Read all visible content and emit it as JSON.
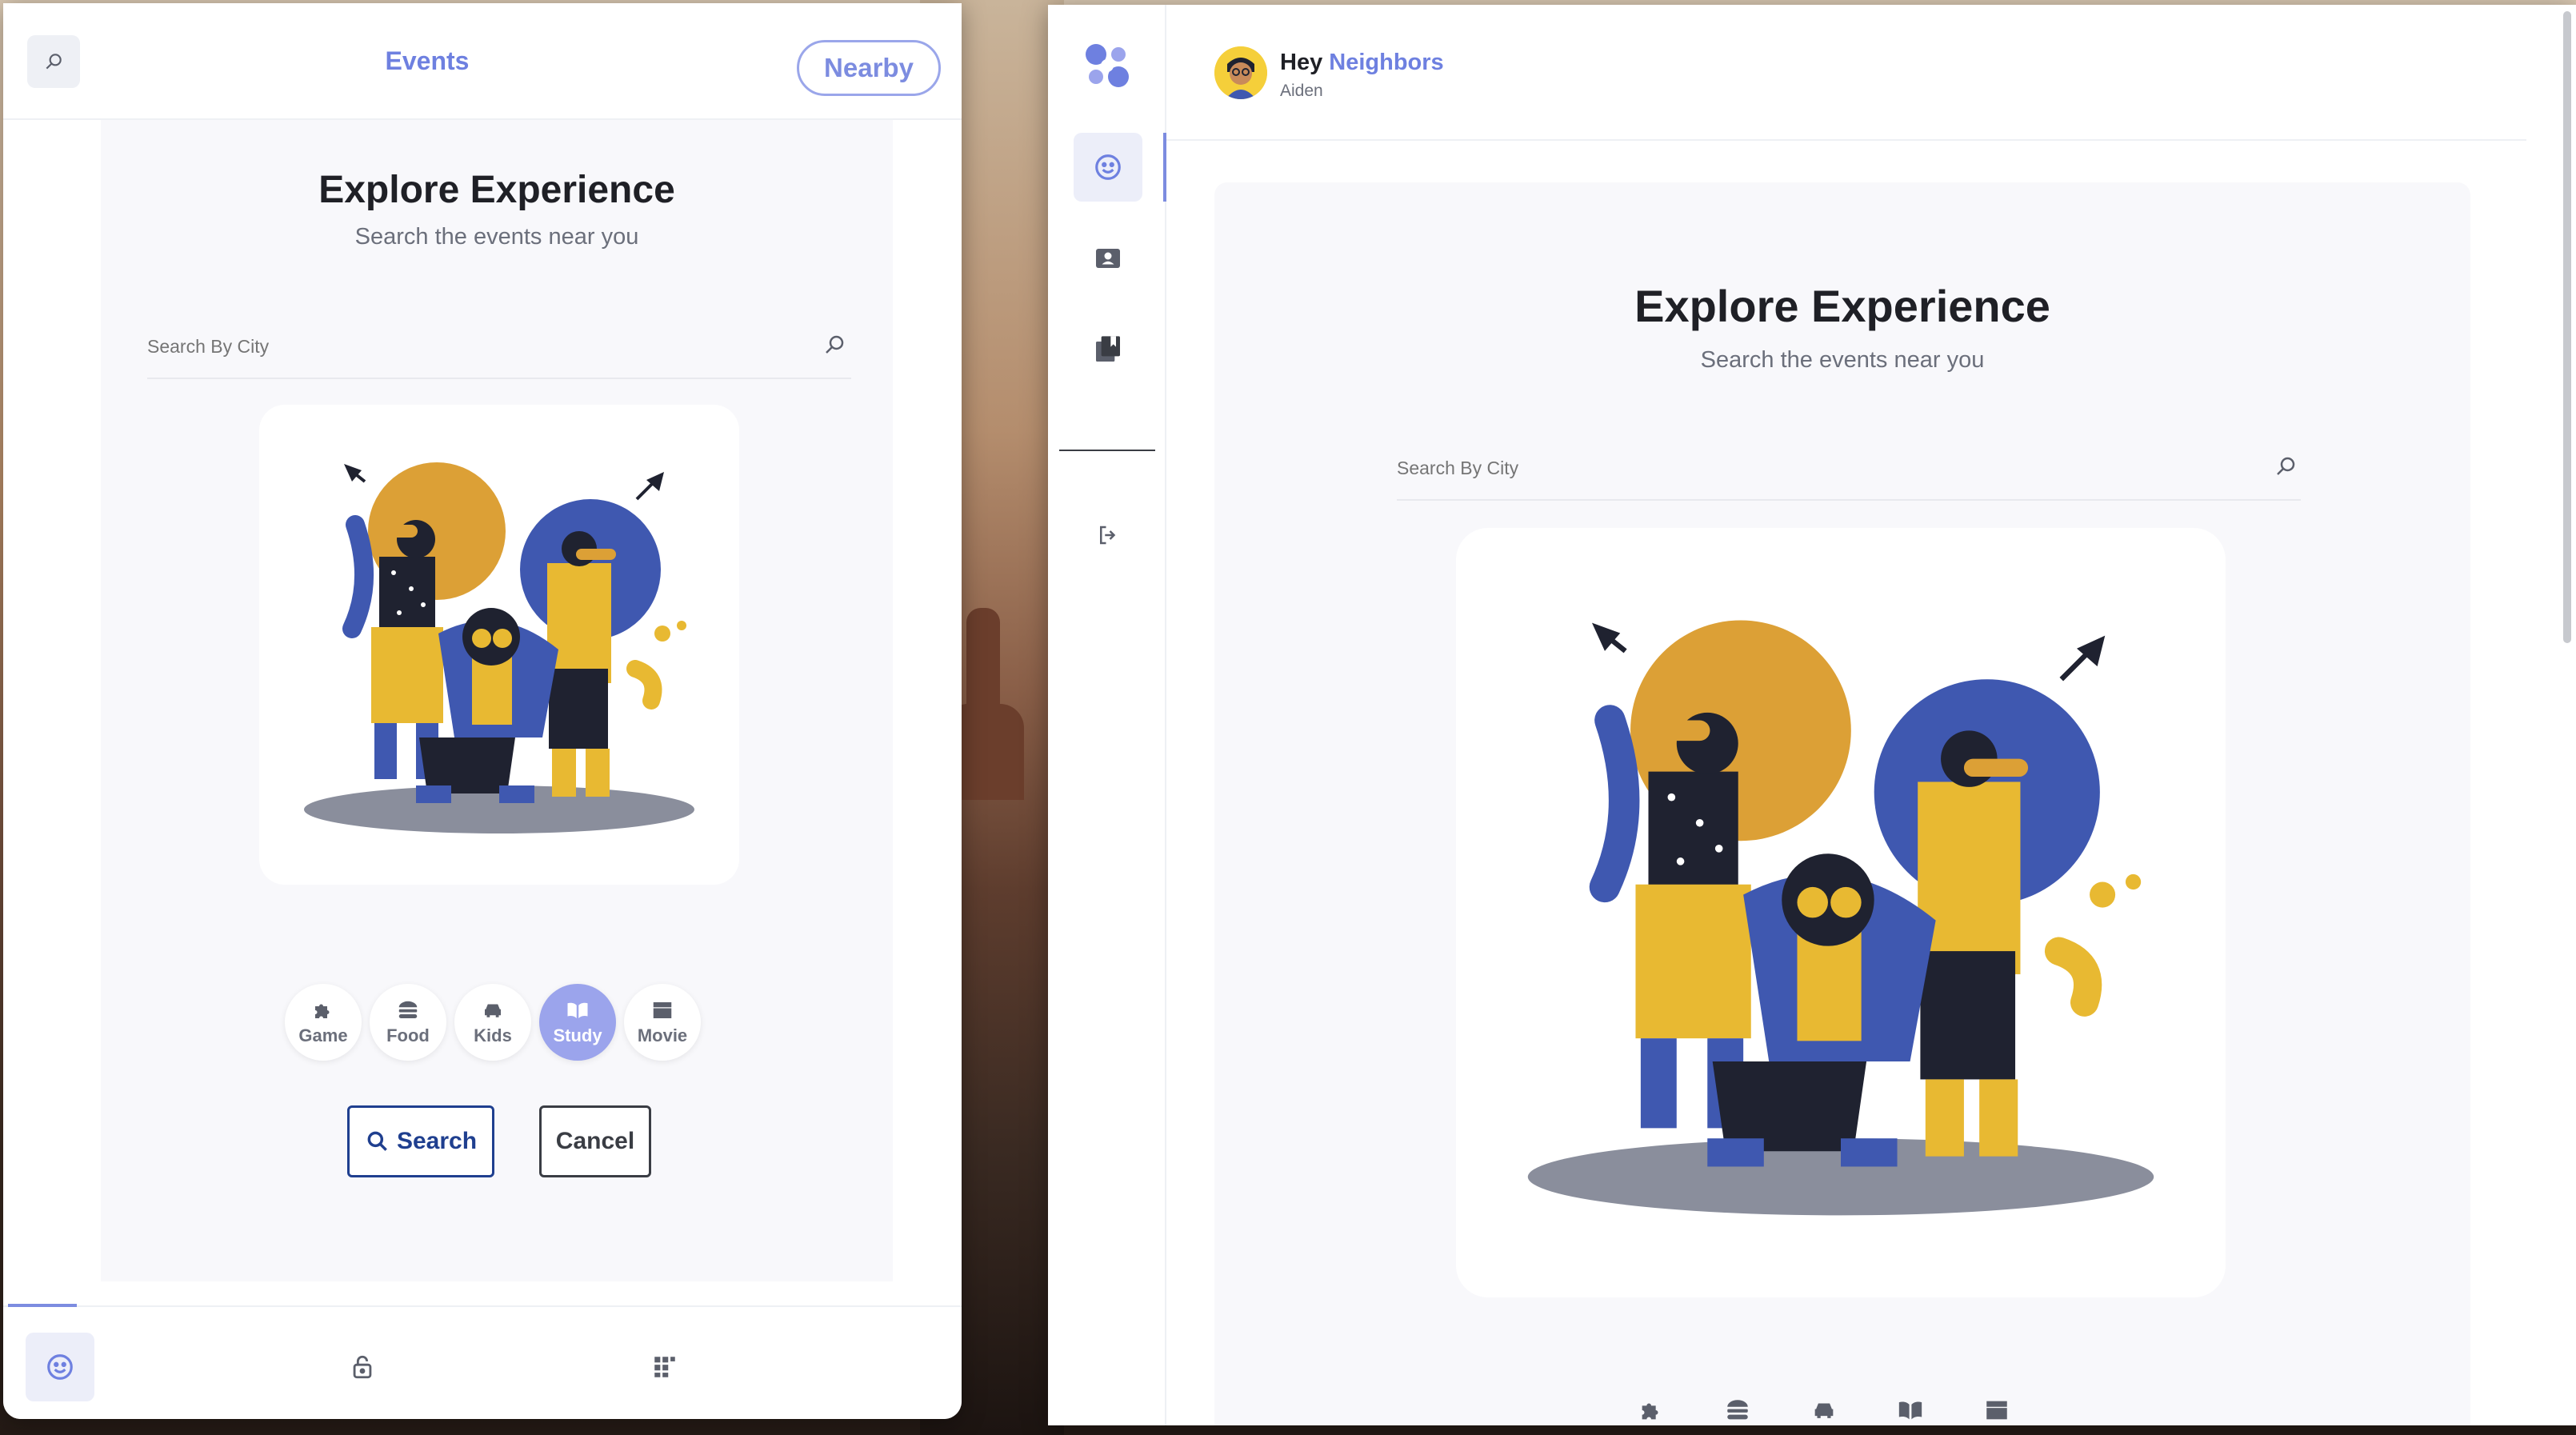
{
  "mobile": {
    "header": {
      "title": "Events",
      "nearby_label": "Nearby"
    },
    "heading": "Explore Experience",
    "subheading": "Search the events near you",
    "search": {
      "placeholder": "Search By City"
    },
    "categories": [
      {
        "label": "Game",
        "icon": "puzzle-icon",
        "active": false
      },
      {
        "label": "Food",
        "icon": "burger-icon",
        "active": false
      },
      {
        "label": "Kids",
        "icon": "car-icon",
        "active": false
      },
      {
        "label": "Study",
        "icon": "book-icon",
        "active": true
      },
      {
        "label": "Movie",
        "icon": "clapperboard-icon",
        "active": false
      }
    ],
    "search_button_label": "Search",
    "cancel_button_label": "Cancel",
    "tabbar": [
      "smile-icon",
      "lock-icon",
      "grid-icon"
    ]
  },
  "desktop": {
    "greeting_prefix": "Hey",
    "greeting_accent": "Neighbors",
    "username": "Aiden",
    "heading": "Explore Experience",
    "subheading": "Search the events near you",
    "search": {
      "placeholder": "Search By City"
    },
    "sidebar": [
      "smile-icon",
      "contact-card-icon",
      "bookmarks-icon",
      "logout-icon"
    ]
  },
  "colors": {
    "accent": "#6e80e0",
    "active_chip": "#9ba4ec",
    "search_button": "#1f3f8f",
    "illustration_yellow": "#e8b932",
    "illustration_blue": "#3f58b0",
    "illustration_orange": "#dca036"
  }
}
